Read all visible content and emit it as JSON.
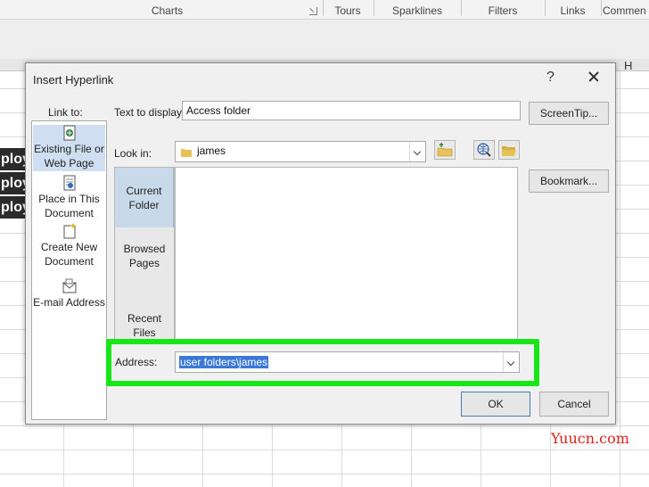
{
  "ribbon": {
    "groups": [
      "Charts",
      "Tours",
      "Sparklines",
      "Filters",
      "Links",
      "Commen"
    ]
  },
  "sheet": {
    "column_letter": "H",
    "cell_fragments": [
      "ploy",
      "ploy",
      "ploy"
    ]
  },
  "dialog": {
    "title": "Insert Hyperlink",
    "help_glyph": "?",
    "link_to_label": "Link to:",
    "link_to_items": [
      {
        "line1": "Existing File or",
        "line2": "Web Page",
        "icon": "existing-file-icon"
      },
      {
        "line1": "Place in This",
        "line2": "Document",
        "icon": "place-in-document-icon"
      },
      {
        "line1": "Create New",
        "line2": "Document",
        "icon": "new-document-icon"
      },
      {
        "line1": "E-mail Address",
        "line2": "",
        "icon": "email-icon"
      }
    ],
    "text_to_display_label": "Text to display:",
    "text_to_display_value": "Access folder",
    "screentip_label": "ScreenTip...",
    "look_in_label": "Look in:",
    "look_in_value": "james",
    "bookmark_label": "Bookmark...",
    "places": [
      {
        "line1": "Current",
        "line2": "Folder"
      },
      {
        "line1": "Browsed",
        "line2": "Pages"
      },
      {
        "line1": "Recent Files",
        "line2": ""
      }
    ],
    "address_label": "Address:",
    "address_value": "user folders\\james",
    "ok_label": "OK",
    "cancel_label": "Cancel",
    "accent_color": "#19e619"
  },
  "watermark": "Yuucn.com"
}
